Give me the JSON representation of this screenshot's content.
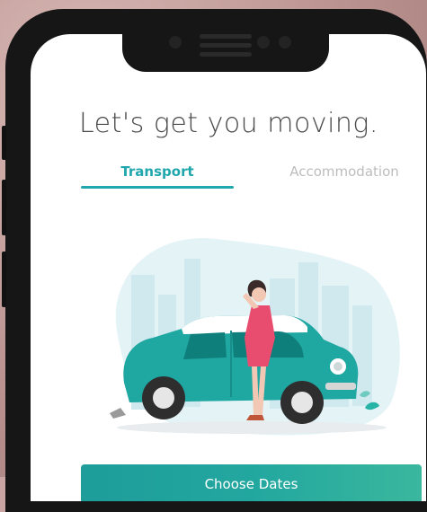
{
  "header": {
    "title": "Let's get you moving."
  },
  "tabs": [
    {
      "label": "Transport",
      "active": true
    },
    {
      "label": "Accommodation",
      "active": false
    }
  ],
  "illustration": {
    "icon": "woman-leaning-on-car-illustration"
  },
  "actions": {
    "primary_label": "Choose Dates"
  },
  "colors": {
    "accent": "#20a7ad",
    "car": "#1fa7a2",
    "button_start": "#1e9d9a",
    "button_end": "#3ab79e",
    "inactive_tab": "#bdbdbd",
    "heading": "#4a4a4a"
  }
}
